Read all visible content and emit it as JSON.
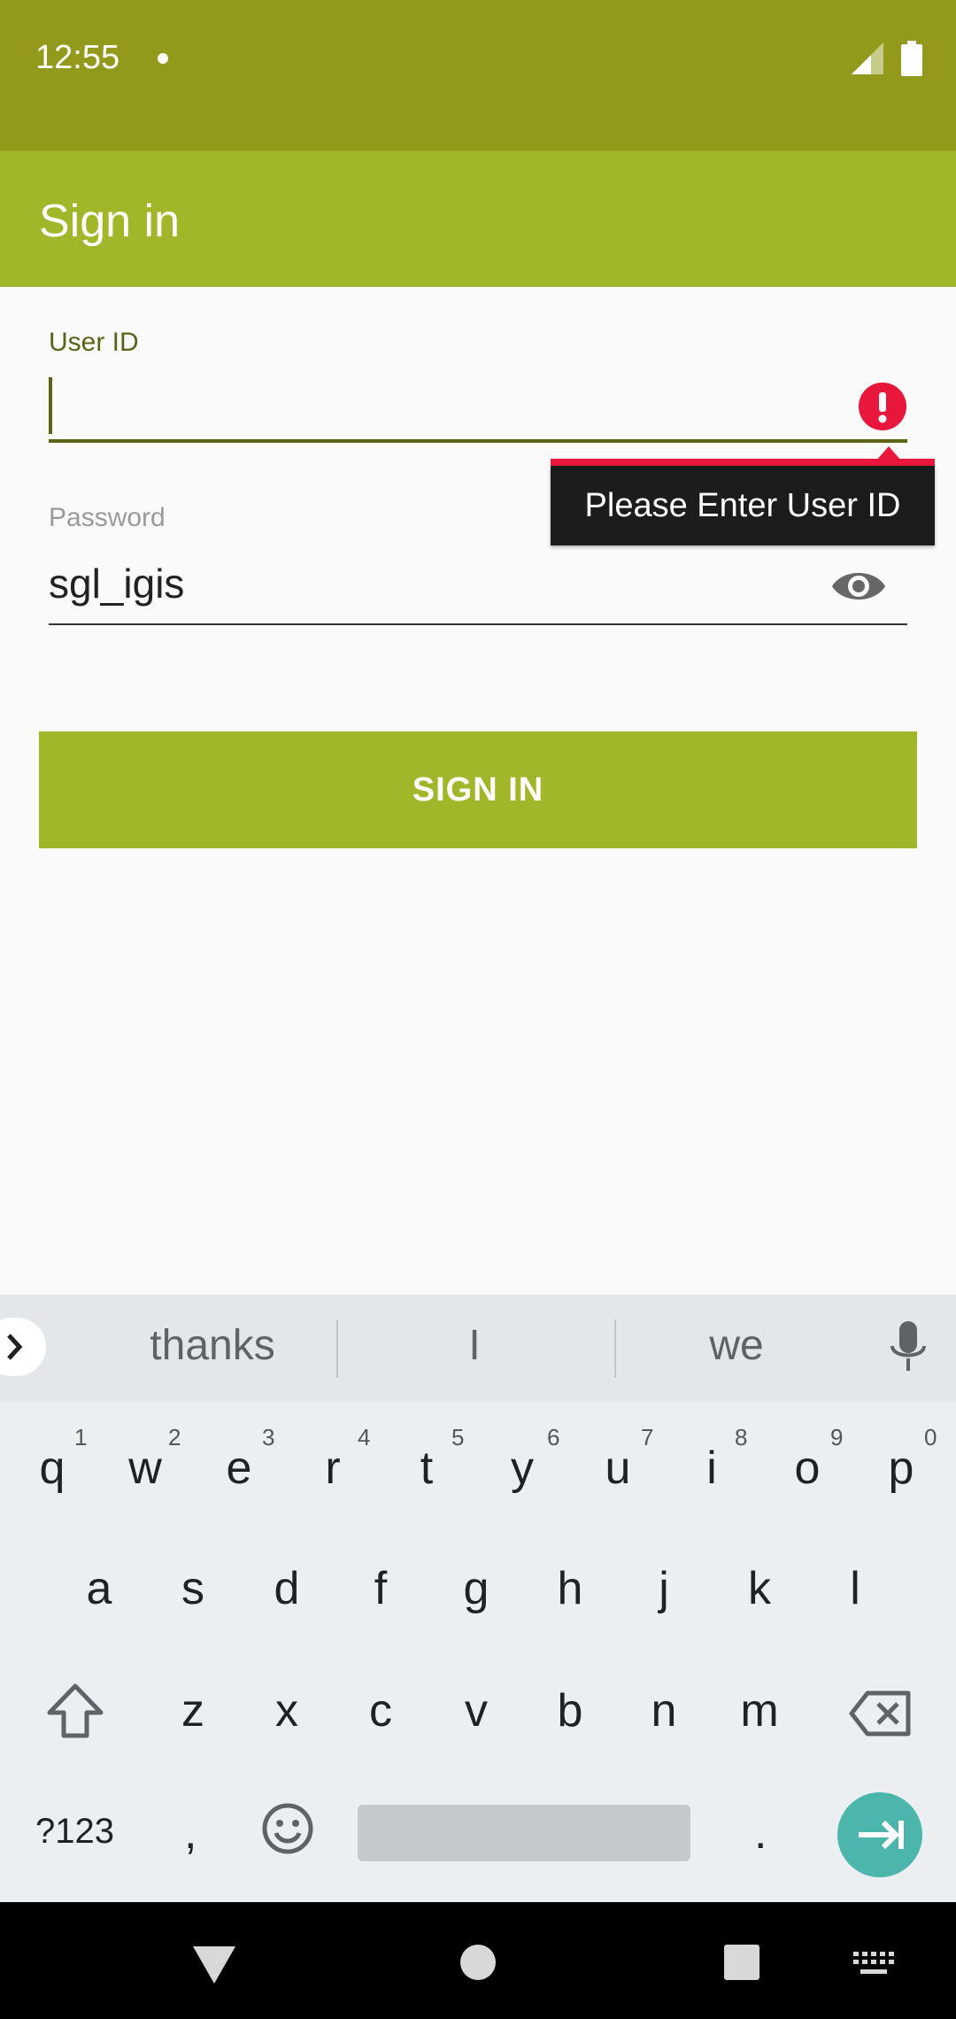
{
  "status_bar": {
    "time": "12:55"
  },
  "app_bar": {
    "title": "Sign in"
  },
  "form": {
    "user_id_label": "User ID",
    "user_id_value": "",
    "error_tooltip": "Please Enter User ID",
    "password_label": "Password",
    "password_value": "sgl_igis",
    "sign_in_button": "SIGN IN"
  },
  "keyboard": {
    "suggestions": [
      "thanks",
      "I",
      "we"
    ],
    "row1": [
      "q",
      "w",
      "e",
      "r",
      "t",
      "y",
      "u",
      "i",
      "o",
      "p"
    ],
    "row1_numbers": [
      "1",
      "2",
      "3",
      "4",
      "5",
      "6",
      "7",
      "8",
      "9",
      "0"
    ],
    "row2": [
      "a",
      "s",
      "d",
      "f",
      "g",
      "h",
      "j",
      "k",
      "l"
    ],
    "row3": [
      "z",
      "x",
      "c",
      "v",
      "b",
      "n",
      "m"
    ],
    "symbols_key": "?123",
    "comma_key": ",",
    "period_key": "."
  },
  "colors": {
    "status_bar": "#92991b",
    "app_bar": "#a2b62a",
    "accent_dark": "#5c6315",
    "error": "#e8173b",
    "enter_key": "#4db6ac"
  }
}
